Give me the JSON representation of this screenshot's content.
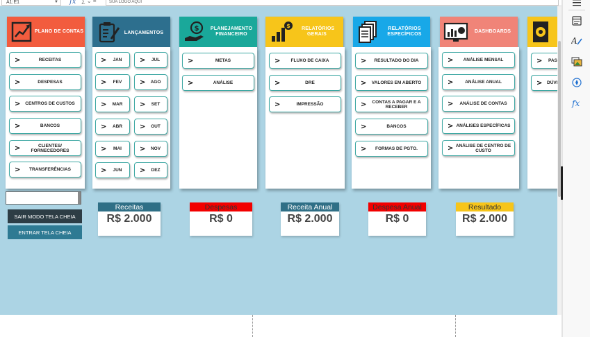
{
  "formula_bar": {
    "name_box": "A1:E1",
    "fx_label": "fx",
    "fx_extra": "∑ ⌄ =",
    "content": "SUA LOGO AQUI"
  },
  "categories": [
    {
      "key": "plano",
      "title": "PLANO DE CONTAS",
      "color": "#f25c3e",
      "text_color": "#ffffff",
      "icon": "chart-growth-icon"
    },
    {
      "key": "lanc",
      "title": "LANÇAMENTOS",
      "color": "#2d6f8e",
      "text_color": "#ffffff",
      "icon": "clipboard-pencil-icon"
    },
    {
      "key": "plan",
      "title": "PLANEJAMENTO FINANCEIRO",
      "color": "#1aa89a",
      "text_color": "#ffffff",
      "icon": "hand-coin-icon"
    },
    {
      "key": "rel",
      "title": "RELATÓRIOS GERAIS",
      "color": "#f7c51a",
      "text_color": "#ffffff",
      "icon": "money-bars-icon"
    },
    {
      "key": "esp",
      "title": "RELATÓRIOS ESPECÍFICOS",
      "color": "#18a8e8",
      "text_color": "#ffffff",
      "icon": "documents-icon"
    },
    {
      "key": "dash",
      "title": "DASHBOARDS",
      "color": "#f08478",
      "text_color": "#ffffff",
      "icon": "dashboard-icon"
    },
    {
      "key": "conf",
      "title": "",
      "color": "#f7c51a",
      "text_color": "#ffffff",
      "icon": "settings-book-icon"
    }
  ],
  "buttons": {
    "plano": [
      "RECEITAS",
      "DESPESAS",
      "CENTROS DE CUSTOS",
      "BANCOS",
      "CLIENTES/ FORNECEDORES",
      "TRANSFERÊNCIAS"
    ],
    "lanc_left": [
      "JAN",
      "FEV",
      "MAR",
      "ABR",
      "MAI",
      "JUN"
    ],
    "lanc_right": [
      "JUL",
      "AGO",
      "SET",
      "OUT",
      "NOV",
      "DEZ"
    ],
    "plan": [
      "METAS",
      "ANÁLISE"
    ],
    "rel": [
      "FLUXO DE CAIXA",
      "DRE",
      "IMPRESSÃO"
    ],
    "esp": [
      "RESULTADO DO DIA",
      "VALORES EM ABERTO",
      "CONTAS A PAGAR E A RECEBER",
      "BANCOS",
      "FORMAS DE PGTO."
    ],
    "dash": [
      "ANÁLISE MENSAL",
      "ANÁLISE ANUAL",
      "ANÁLISE DE CONTAS",
      "ANÁLISES ESPECÍFICAS",
      "ANÁLISE DE CENTRO DE CUSTO"
    ],
    "conf": [
      "PAS",
      "DÚVI"
    ]
  },
  "controls": {
    "exit_fullscreen": "SAIR MODO TELA CHEIA",
    "enter_fullscreen": "ENTRAR TELA CHEIA"
  },
  "summary": [
    {
      "title": "Receitas",
      "value": "R$ 2.000",
      "color": "#2f6f86",
      "text_color": "#ffffff"
    },
    {
      "title": "Despesas",
      "value": "R$ 0",
      "color": "#f20000",
      "text_color": "#333333"
    },
    {
      "title": "Receita Anual",
      "value": "R$ 2.000",
      "color": "#2f6f86",
      "text_color": "#ffffff"
    },
    {
      "title": "Despesa Anual",
      "value": "R$ 0",
      "color": "#f20000",
      "text_color": "#333333"
    },
    {
      "title": "Resultado",
      "value": "R$ 2.000",
      "color": "#f7c51a",
      "text_color": "#333333"
    }
  ]
}
